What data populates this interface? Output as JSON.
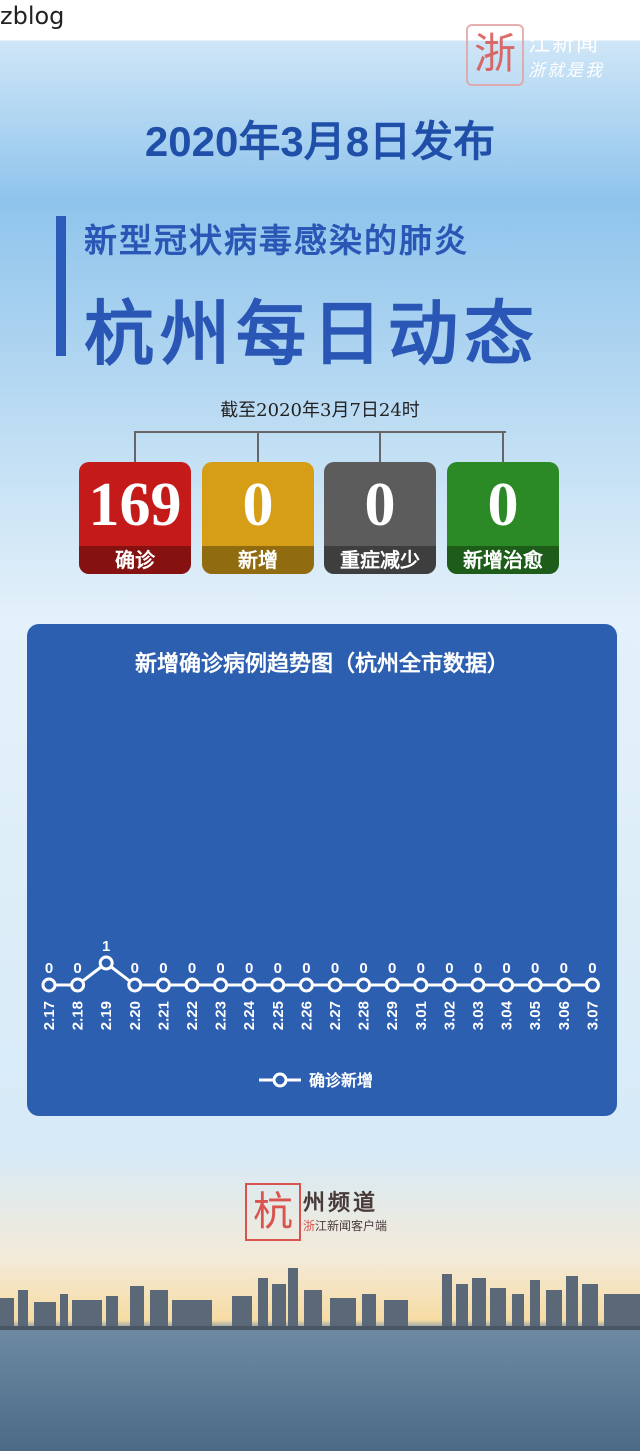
{
  "watermark": "zblog",
  "brand": {
    "logo_char": "浙",
    "name": "江新闻",
    "slogan": "浙就是我"
  },
  "date_title": "2020年3月8日发布",
  "subtitle": "新型冠状病毒感染的肺炎",
  "main_title": "杭州每日动态",
  "as_of": "截至2020年3月7日24时",
  "stats": [
    {
      "value": "169",
      "label": "确诊",
      "color": "#c51a1a"
    },
    {
      "value": "0",
      "label": "新增",
      "color": "#d69e17"
    },
    {
      "value": "0",
      "label": "重症减少",
      "color": "#5c5c5c"
    },
    {
      "value": "0",
      "label": "新增治愈",
      "color": "#2c8a26"
    }
  ],
  "chart_data": {
    "type": "line",
    "title": "新增确诊病例趋势图（杭州全市数据）",
    "categories": [
      "2.17",
      "2.18",
      "2.19",
      "2.20",
      "2.21",
      "2.22",
      "2.23",
      "2.24",
      "2.25",
      "2.26",
      "2.27",
      "2.28",
      "2.29",
      "3.01",
      "3.02",
      "3.03",
      "3.04",
      "3.05",
      "3.06",
      "3.07"
    ],
    "series": [
      {
        "name": "确诊新增",
        "values": [
          0,
          0,
          1,
          0,
          0,
          0,
          0,
          0,
          0,
          0,
          0,
          0,
          0,
          0,
          0,
          0,
          0,
          0,
          0,
          0
        ]
      }
    ],
    "legend_position": "bottom",
    "line_color": "#ffffff"
  },
  "footer_logo": {
    "char": "杭",
    "name": "州频道",
    "sub_char": "浙",
    "sub": "江新闻客户端"
  }
}
